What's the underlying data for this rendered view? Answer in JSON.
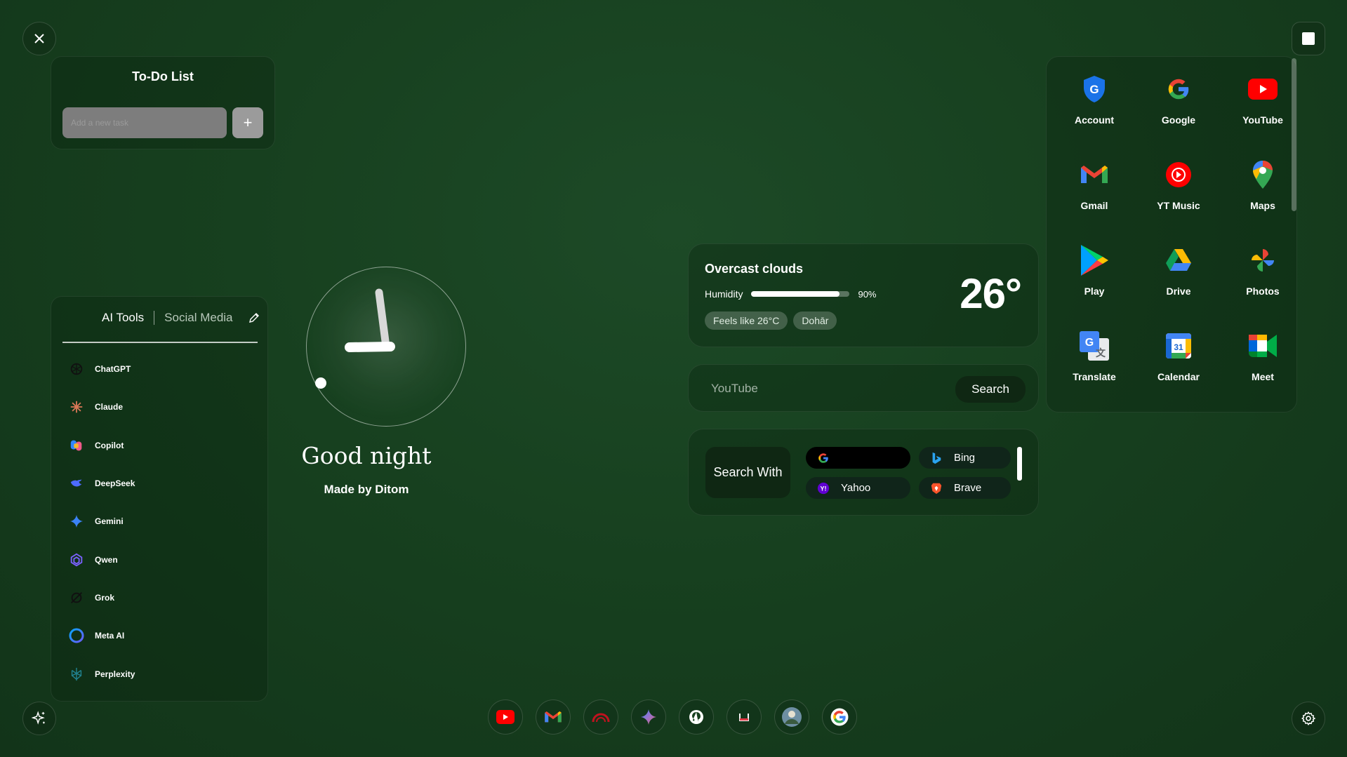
{
  "todo": {
    "title": "To-Do List",
    "placeholder": "Add a new task",
    "add_label": "+"
  },
  "ai_panel": {
    "tabs": [
      "AI Tools",
      "Social Media"
    ],
    "items": [
      {
        "label": "ChatGPT",
        "icon": "chatgpt-icon"
      },
      {
        "label": "Claude",
        "icon": "claude-icon"
      },
      {
        "label": "Copilot",
        "icon": "copilot-icon"
      },
      {
        "label": "DeepSeek",
        "icon": "deepseek-icon"
      },
      {
        "label": "Gemini",
        "icon": "gemini-icon"
      },
      {
        "label": "Qwen",
        "icon": "qwen-icon"
      },
      {
        "label": "Grok",
        "icon": "grok-icon"
      },
      {
        "label": "Meta AI",
        "icon": "meta-ai-icon"
      },
      {
        "label": "Perplexity",
        "icon": "perplexity-icon"
      }
    ]
  },
  "clock": {
    "greeting": "Good night",
    "credit": "Made by Ditom"
  },
  "weather": {
    "condition": "Overcast clouds",
    "humidity_label": "Humidity",
    "humidity_value": "90%",
    "humidity_fraction": 0.9,
    "feels_like": "Feels like 26°C",
    "location": "Dohār",
    "temperature": "26°"
  },
  "youtube_search": {
    "placeholder": "YouTube",
    "button": "Search"
  },
  "search_with": {
    "label": "Search With",
    "engines": [
      {
        "name": "",
        "icon": "google-icon"
      },
      {
        "name": "Bing",
        "icon": "bing-icon"
      },
      {
        "name": "Yahoo",
        "icon": "yahoo-icon"
      },
      {
        "name": "Brave",
        "icon": "brave-icon"
      }
    ]
  },
  "apps": [
    {
      "label": "Account"
    },
    {
      "label": "Google"
    },
    {
      "label": "YouTube"
    },
    {
      "label": "Gmail"
    },
    {
      "label": "YT Music"
    },
    {
      "label": "Maps"
    },
    {
      "label": "Play"
    },
    {
      "label": "Drive"
    },
    {
      "label": "Photos"
    },
    {
      "label": "Translate"
    },
    {
      "label": "Calendar"
    },
    {
      "label": "Meet"
    }
  ],
  "dock": [
    "youtube-icon",
    "gmail-icon",
    "speedometer-icon",
    "gemini-icon",
    "github-icon",
    "tray-icon",
    "profile-icon",
    "google-icon"
  ],
  "colors": {
    "background": "#17401f",
    "accent_white": "#ffffff",
    "youtube_red": "#ff0000"
  }
}
